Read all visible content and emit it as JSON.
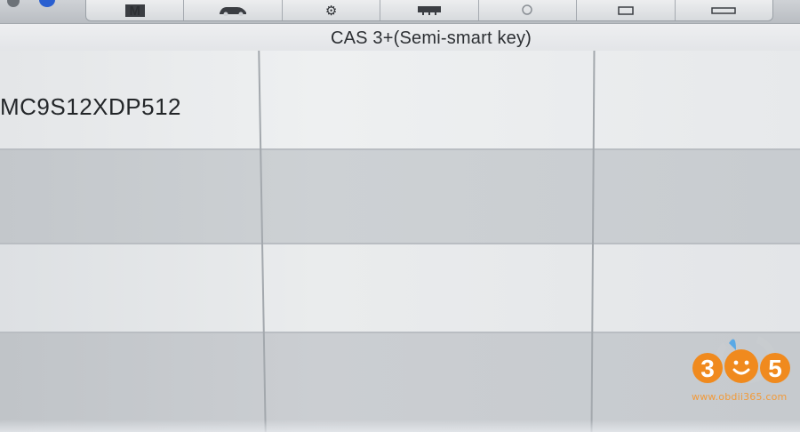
{
  "window": {
    "title": "CAS 3+(Semi-smart key)"
  },
  "toolbar": {
    "tabs": [
      {
        "icon": "m-icon",
        "glyph": "M"
      },
      {
        "icon": "car-icon",
        "glyph": "🚗"
      },
      {
        "icon": "gear-icon",
        "glyph": "⚙"
      },
      {
        "icon": "chip-icon",
        "glyph": "▭"
      },
      {
        "icon": "circle-icon",
        "glyph": "◯"
      },
      {
        "icon": "square-icon",
        "glyph": "▢"
      },
      {
        "icon": "chat-icon",
        "glyph": "▱"
      }
    ]
  },
  "table": {
    "rows": [
      {
        "cells": [
          "MC9S12XDP512",
          "",
          ""
        ]
      },
      {
        "cells": [
          "",
          "",
          ""
        ]
      },
      {
        "cells": [
          "",
          "",
          ""
        ]
      },
      {
        "cells": [
          "",
          "",
          ""
        ]
      }
    ]
  },
  "watermark": {
    "digits": [
      "3",
      "5"
    ],
    "site": "www.obdii365.com"
  },
  "colors": {
    "watermark_orange": "#f08a1e",
    "accent_blue": "#2a5fd0"
  }
}
